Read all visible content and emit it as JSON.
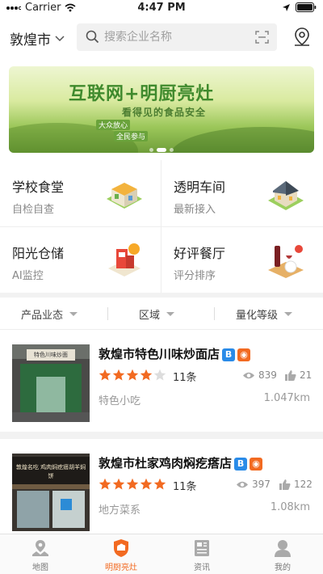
{
  "status_bar": {
    "carrier": "Carrier",
    "time": "4:47 PM"
  },
  "header": {
    "city": "敦煌市",
    "search_placeholder": "搜索企业名称"
  },
  "banner": {
    "title": "互联网+明厨亮灶",
    "subtitle": "看得见的食品安全",
    "tag1": "大众放心",
    "tag2": "全民参与"
  },
  "categories": [
    {
      "title": "学校食堂",
      "subtitle": "自检自查"
    },
    {
      "title": "透明车间",
      "subtitle": "最新接入"
    },
    {
      "title": "阳光仓储",
      "subtitle": "AI监控"
    },
    {
      "title": "好评餐厅",
      "subtitle": "评分排序"
    }
  ],
  "filters": [
    "产品业态",
    "区域",
    "量化等级"
  ],
  "restaurants": [
    {
      "name": "敦煌市特色川味炒面店",
      "rating": 4,
      "reviews": "11条",
      "views": "839",
      "likes": "21",
      "category": "特色小吃",
      "distance": "1.047km",
      "sign_text": "特色川味炒面"
    },
    {
      "name": "敦煌市杜家鸡肉焖疙瘩店",
      "rating": 5,
      "reviews": "11条",
      "views": "397",
      "likes": "122",
      "category": "地方菜系",
      "distance": "1.08km",
      "sign_text": "敦煌名吃 鸡肉焖疙瘩胡羊焖饼"
    }
  ],
  "tabs": [
    {
      "label": "地图",
      "icon": "map-pin-icon"
    },
    {
      "label": "明厨亮灶",
      "icon": "kitchen-icon"
    },
    {
      "label": "资讯",
      "icon": "news-icon"
    },
    {
      "label": "我的",
      "icon": "user-icon"
    }
  ],
  "colors": {
    "accent": "#f26a21",
    "star": "#f26a21",
    "badge_blue": "#2a8be8"
  }
}
